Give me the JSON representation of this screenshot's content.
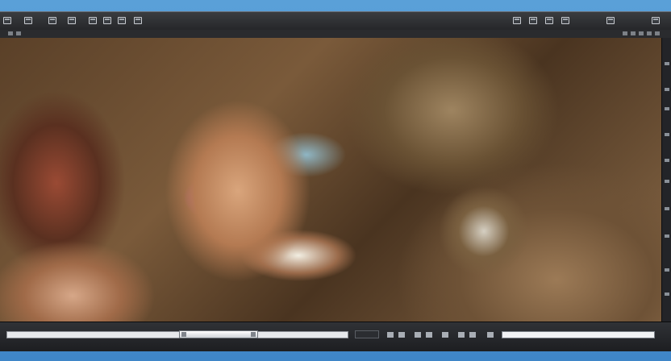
{
  "toolbar": {
    "left_icons": [
      "monitor-icon",
      "image-icon",
      "folder-icon",
      "film-icon",
      "window-icon",
      "crop-icon",
      "layers-icon",
      "panel-icon"
    ],
    "right_icons": [
      "grid-icon",
      "zoom-icon",
      "settings-icon",
      "expand-icon",
      "fullscreen-icon",
      "close-icon"
    ]
  },
  "canvas": {
    "image_subject": "creature-face-artwork"
  },
  "right_panel": {
    "icons": [
      "tool-1",
      "tool-2",
      "tool-3",
      "tool-4",
      "tool-5",
      "tool-6",
      "tool-7",
      "tool-8",
      "tool-9",
      "tool-10"
    ]
  },
  "bottom_bar": {
    "scroll_position": 0.52,
    "scroll_extent": 0.23,
    "progress": 0.0,
    "icons": [
      "page-icon",
      "info-icon",
      "lock-icon",
      "nav-icon",
      "layout-icon",
      "view-icon",
      "list-icon",
      "tag-icon"
    ]
  }
}
